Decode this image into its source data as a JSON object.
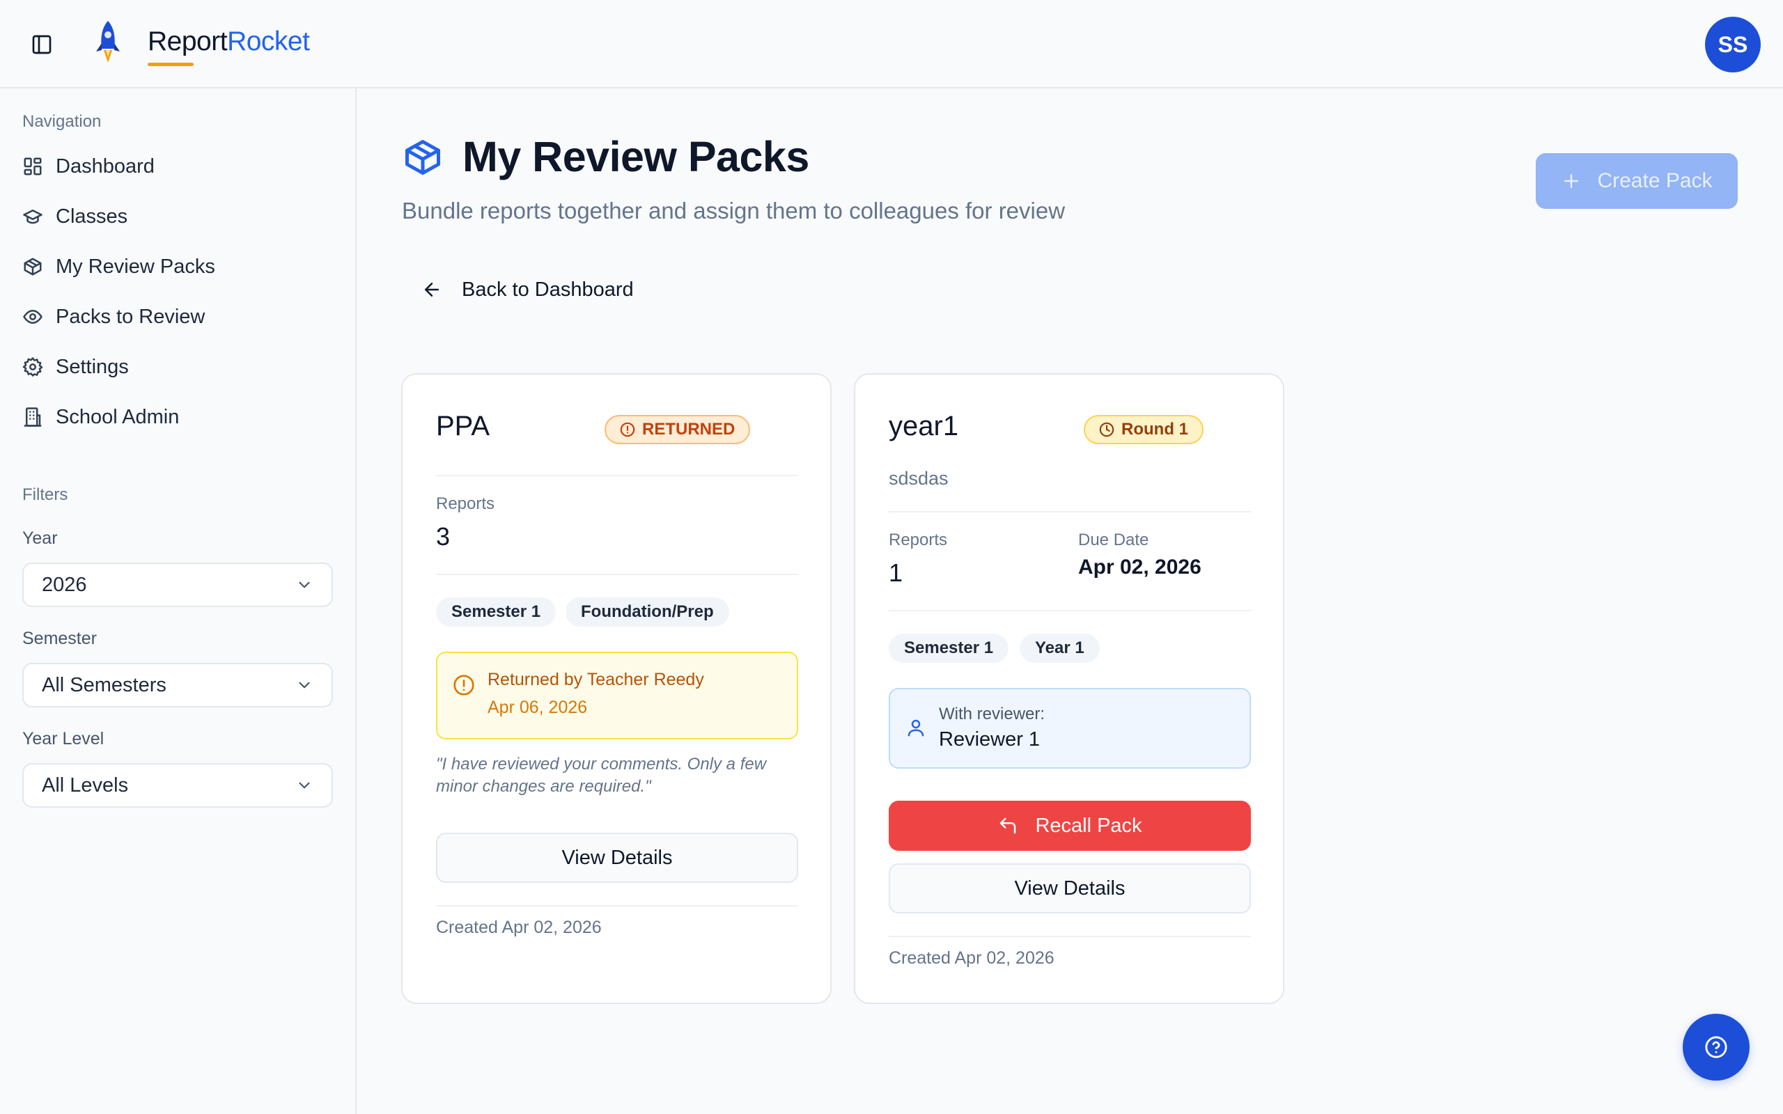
{
  "header": {
    "brand_part1": "Report",
    "brand_part2": "Rocket",
    "avatar_initials": "SS",
    "toggle_icon": "sidebar-toggle-icon"
  },
  "sidebar": {
    "nav_heading": "Navigation",
    "items": [
      {
        "label": "Dashboard",
        "icon": "dashboard-icon"
      },
      {
        "label": "Classes",
        "icon": "graduation-cap-icon"
      },
      {
        "label": "My Review Packs",
        "icon": "package-icon"
      },
      {
        "label": "Packs to Review",
        "icon": "eye-icon"
      },
      {
        "label": "Settings",
        "icon": "gear-icon"
      },
      {
        "label": "School Admin",
        "icon": "building-icon"
      }
    ],
    "filters_heading": "Filters",
    "filters": {
      "year_label": "Year",
      "year_value": "2026",
      "semester_label": "Semester",
      "semester_value": "All Semesters",
      "level_label": "Year Level",
      "level_value": "All Levels"
    }
  },
  "main": {
    "title": "My Review Packs",
    "subtitle": "Bundle reports together and assign them to colleagues for review",
    "create_button": "Create Pack",
    "back_link": "Back to Dashboard"
  },
  "cards": [
    {
      "title": "PPA",
      "badge": "RETURNED",
      "reports_label": "Reports",
      "reports_value": "3",
      "chips": [
        "Semester 1",
        "Foundation/Prep"
      ],
      "returned_by": "Returned by Teacher Reedy",
      "returned_date": "Apr 06, 2026",
      "comment": "\"I have reviewed your comments. Only a few minor changes are required.\"",
      "view_button": "View Details",
      "created": "Created Apr 02, 2026"
    },
    {
      "title": "year1",
      "badge": "Round 1",
      "description": "sdsdas",
      "reports_label": "Reports",
      "reports_value": "1",
      "due_label": "Due Date",
      "due_value": "Apr 02, 2026",
      "chips": [
        "Semester 1",
        "Year 1"
      ],
      "reviewer_label": "With reviewer:",
      "reviewer_name": "Reviewer 1",
      "recall_button": "Recall Pack",
      "view_button": "View Details",
      "created": "Created Apr 02, 2026"
    }
  ],
  "colors": {
    "accent": "#2563eb",
    "danger": "#ef4444",
    "brand_underline": "#f59e0b"
  }
}
